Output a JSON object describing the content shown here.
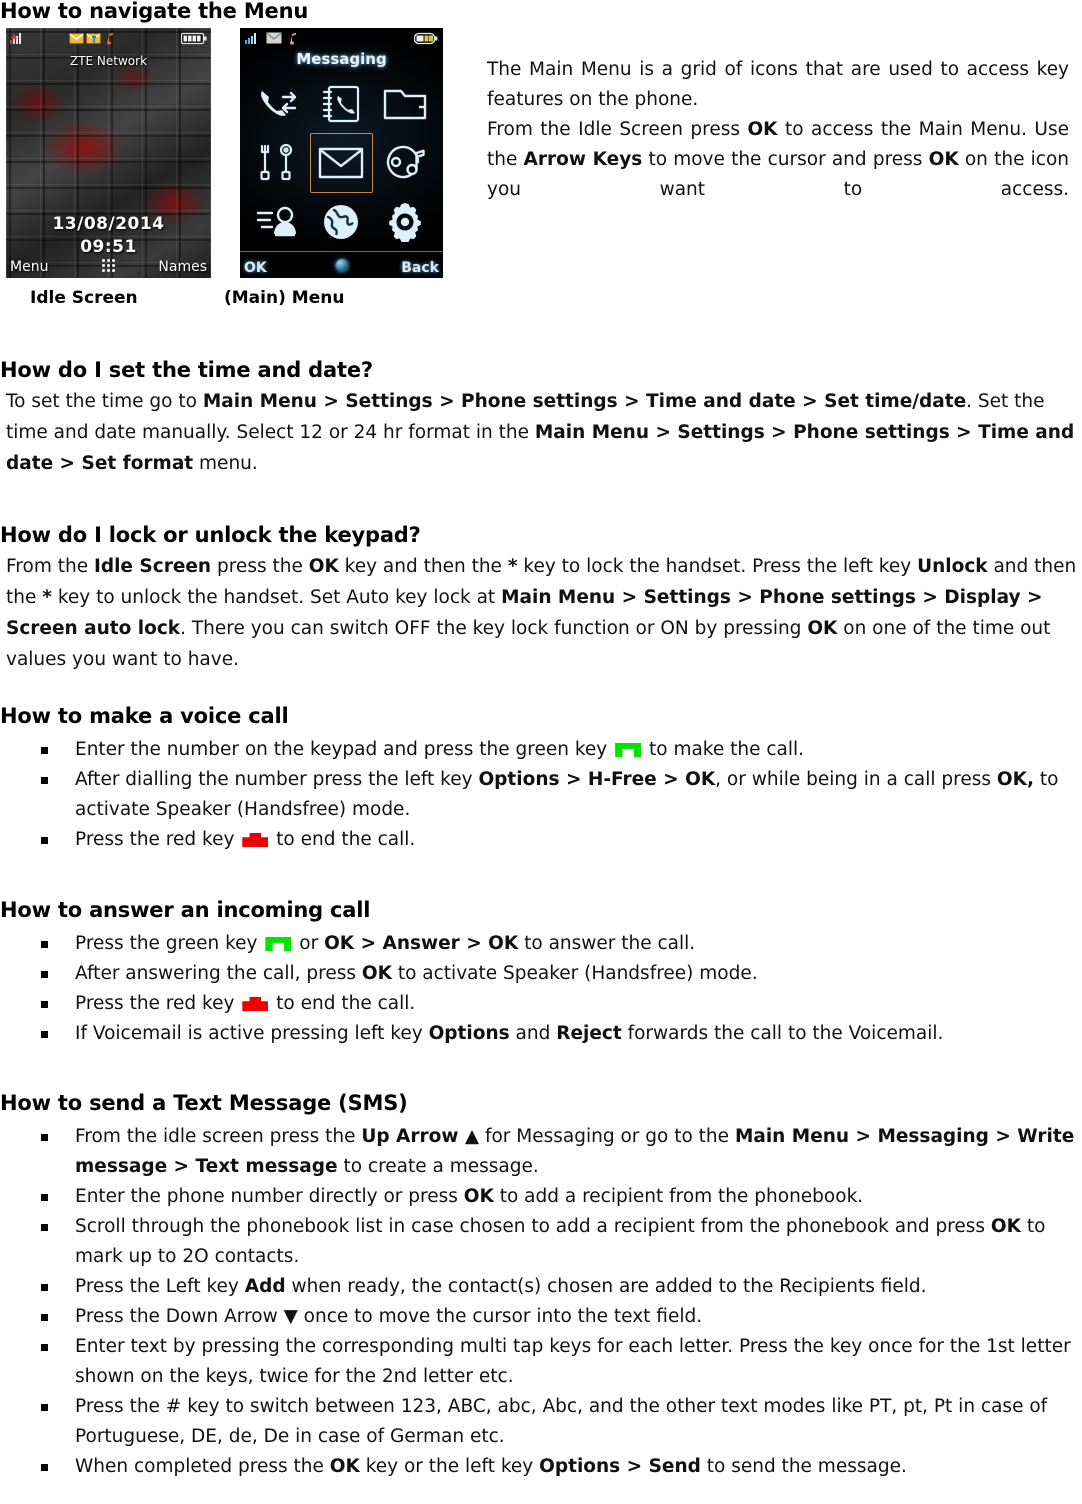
{
  "document": {
    "title": "How to navigate the Menu"
  },
  "navigate_section": {
    "heading": "How to navigate the Menu",
    "description_line1": "The Main Menu is a grid of icons that are used to access key features on the phone.",
    "description_line2_a": "From the Idle Screen press ",
    "description_ok1": "OK",
    "description_line2_b": " to access the Main Menu. Use the ",
    "description_arrow_keys": "Arrow Keys",
    "description_line2_c": " to move the cursor and press ",
    "description_ok2": "OK",
    "description_line2_d": " on the icon you want to access.",
    "caption_idle": "Idle Screen",
    "caption_menu": "(Main) Menu"
  },
  "idle_screen": {
    "network_name": "ZTE Network",
    "date": "13/08/2014",
    "time": "09:51",
    "softkey_left": "Menu",
    "softkey_right": "Names",
    "center_icon": "grid-dots-icon",
    "status_icons": [
      "signal-icon",
      "envelope-icon",
      "envelope-arrow-icon",
      "music-note-icon",
      "battery-full-icon"
    ]
  },
  "menu_screen": {
    "title": "Messaging",
    "softkey_left": "OK",
    "softkey_right": "Back",
    "center_icon": "navigation-ball-icon",
    "status_icons": [
      "signal-icon",
      "envelope-icon",
      "music-note-icon",
      "battery-icon"
    ],
    "icons": [
      {
        "name": "call-log-icon",
        "label": "Call log",
        "selected": false
      },
      {
        "name": "phonebook-icon",
        "label": "Phonebook",
        "selected": false
      },
      {
        "name": "file-manager-icon",
        "label": "File manager",
        "selected": false
      },
      {
        "name": "tools-icon",
        "label": "Tools",
        "selected": false
      },
      {
        "name": "messaging-icon",
        "label": "Messaging",
        "selected": true
      },
      {
        "name": "music-player-icon",
        "label": "Music",
        "selected": false
      },
      {
        "name": "profiles-icon",
        "label": "Profiles",
        "selected": false
      },
      {
        "name": "browser-icon",
        "label": "Browser",
        "selected": false
      },
      {
        "name": "settings-icon",
        "label": "Settings",
        "selected": false
      }
    ]
  },
  "time_date_section": {
    "heading": "How do I set the time and date?",
    "p1_a": "To set the time go to ",
    "p1_bold": "Main Menu > Settings > Phone settings > Time and date > Set time/date",
    "p1_b": ". Set the time and date manually. Select 12 or 24 hr format in the ",
    "p1_bold2": "Main Menu > Settings > Phone settings > Time and date > Set format",
    "p1_c": " menu."
  },
  "keypad_lock_section": {
    "heading": "How do I lock or unlock the keypad?",
    "p1_a": "From the ",
    "p1_b1": "Idle Screen",
    "p1_b": " press the ",
    "p1_b2": "OK",
    "p1_c": " key and then the ",
    "p1_b3": "*",
    "p1_d": " key to lock the handset. Press the left key ",
    "p1_b4": "Unlock",
    "p1_e": " and then the ",
    "p1_b5": "*",
    "p1_f": " key to unlock the handset. Set Auto key lock at ",
    "p1_b6": "Main Menu > Settings > Phone settings > Display > Screen auto lock",
    "p1_g": ". There you can switch OFF the key lock function or ON by pressing ",
    "p1_b7": "OK",
    "p1_h": " on one of the time out values you want to have."
  },
  "voice_call_section": {
    "heading": "How to make a voice call",
    "bullets": [
      {
        "parts": [
          {
            "t": "Enter the number on the keypad and press the green key ",
            "b": false
          },
          {
            "t": "",
            "icon": "green-call-key-icon"
          },
          {
            "t": " to make the call.",
            "b": false
          }
        ]
      },
      {
        "parts": [
          {
            "t": "After dialling the number press the left key ",
            "b": false
          },
          {
            "t": "Options > H-Free > OK",
            "b": true
          },
          {
            "t": ", or while being in a call press ",
            "b": false
          },
          {
            "t": "OK,",
            "b": true
          },
          {
            "t": " to activate Speaker (Handsfree) mode.",
            "b": false
          }
        ]
      },
      {
        "parts": [
          {
            "t": "Press the red key ",
            "b": false
          },
          {
            "t": "",
            "icon": "red-end-key-icon"
          },
          {
            "t": " to end the call.",
            "b": false
          }
        ]
      }
    ]
  },
  "answer_call_section": {
    "heading": "How to answer an incoming call",
    "bullets": [
      {
        "parts": [
          {
            "t": "Press the green key ",
            "b": false
          },
          {
            "t": "",
            "icon": "green-call-key-icon"
          },
          {
            "t": " or ",
            "b": false
          },
          {
            "t": "OK > Answer > OK",
            "b": true
          },
          {
            "t": " to answer the call.",
            "b": false
          }
        ]
      },
      {
        "parts": [
          {
            "t": "After answering the call, press ",
            "b": false
          },
          {
            "t": "OK",
            "b": true
          },
          {
            "t": " to activate Speaker (Handsfree) mode.",
            "b": false
          }
        ]
      },
      {
        "parts": [
          {
            "t": "Press the red key ",
            "b": false
          },
          {
            "t": "",
            "icon": "red-end-key-icon"
          },
          {
            "t": " to end the call.",
            "b": false
          }
        ]
      },
      {
        "parts": [
          {
            "t": "If Voicemail is active pressing left key ",
            "b": false
          },
          {
            "t": "Options",
            "b": true
          },
          {
            "t": " and ",
            "b": false
          },
          {
            "t": "Reject",
            "b": true
          },
          {
            "t": " forwards the call to the Voicemail.",
            "b": false
          }
        ]
      }
    ]
  },
  "sms_section": {
    "heading": "How to send a Text Message (SMS)",
    "bullets": [
      {
        "parts": [
          {
            "t": "From the idle screen press the ",
            "b": false
          },
          {
            "t": "Up Arrow ▲",
            "b": true
          },
          {
            "t": " for Messaging or go to the ",
            "b": false
          },
          {
            "t": "Main Menu > Messaging > Write message > Text message",
            "b": true
          },
          {
            "t": " to create a message.",
            "b": false
          }
        ]
      },
      {
        "parts": [
          {
            "t": "Enter the phone number directly or press ",
            "b": false
          },
          {
            "t": "OK",
            "b": true
          },
          {
            "t": " to add a recipient from the phonebook.",
            "b": false
          }
        ]
      },
      {
        "parts": [
          {
            "t": "Scroll through the phonebook list in case chosen to add a recipient from the phonebook and press ",
            "b": false
          },
          {
            "t": "OK",
            "b": true
          },
          {
            "t": " to mark up to 2O contacts.",
            "b": false
          }
        ]
      },
      {
        "parts": [
          {
            "t": "Press the Left key ",
            "b": false
          },
          {
            "t": "Add",
            "b": true
          },
          {
            "t": " when ready, the contact(s) chosen are added to the Recipients field.",
            "b": false
          }
        ]
      },
      {
        "parts": [
          {
            "t": "Press the Down Arrow ▼ once to move the cursor into the text field.",
            "b": false
          }
        ]
      },
      {
        "parts": [
          {
            "t": "Enter text by pressing the corresponding multi tap keys for each letter. Press the key once for the 1st letter shown on the keys, twice for the 2nd letter etc.",
            "b": false
          }
        ]
      },
      {
        "parts": [
          {
            "t": "Press the # key to switch between 123, ABC, abc, Abc, and the other text modes like PT, pt, Pt in case of Portuguese, DE, de, De in case of German etc.",
            "b": false
          }
        ]
      },
      {
        "parts": [
          {
            "t": "When completed press the ",
            "b": false
          },
          {
            "t": "OK",
            "b": true
          },
          {
            "t": " key or the left key ",
            "b": false
          },
          {
            "t": "Options > Send",
            "b": true
          },
          {
            "t": " to send the message.",
            "b": false
          }
        ]
      }
    ]
  },
  "colors": {
    "green_key": "#00E400",
    "red_key": "#EE0000",
    "menu_highlight": "#C08A40",
    "menu_icon": "#DCEFFA"
  }
}
